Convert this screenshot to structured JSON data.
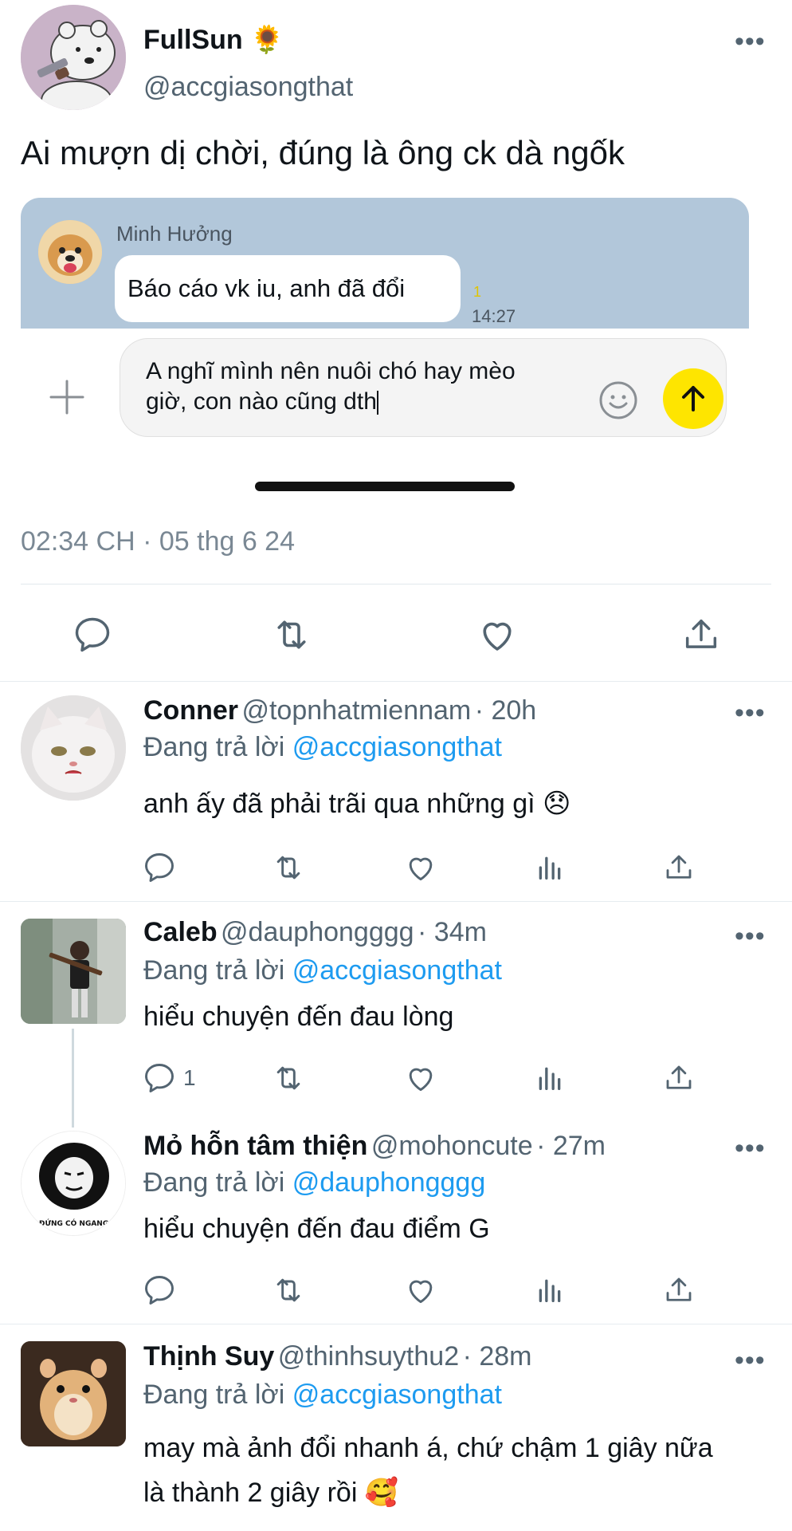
{
  "main_tweet": {
    "display_name": "FullSun",
    "name_emoji": "🌻",
    "handle": "@accgiasongthat",
    "text": "Ai mượn dị chời, đúng là ông ck dà ngốk",
    "timestamp": "02:34 CH · 05 thg 6 24",
    "embedded_chat": {
      "sender": "Minh Hưởng",
      "message": "Báo cáo vk iu, anh đã đổi",
      "read_count": "1",
      "time": "14:27",
      "input_text": "A nghĩ mình nên nuôi chó hay mèo giờ, con nào cũng dth",
      "input_line1": "A nghĩ mình nên nuôi chó hay mèo",
      "input_line2": "giờ, con nào cũng dth"
    }
  },
  "replying_prefix": "Đang trả lời",
  "replies": [
    {
      "name": "Conner",
      "handle": "@topnhatmiennam",
      "time": "· 20h",
      "replying_to": "@accgiasongthat",
      "text": "anh ấy đã phải trãi qua những gì 😞",
      "reply_count": ""
    },
    {
      "name": "Caleb",
      "handle": "@dauphongggg",
      "time": "· 34m",
      "replying_to": "@accgiasongthat",
      "text": "hiểu chuyện đến đau lòng",
      "reply_count": "1"
    },
    {
      "name": "Mỏ hỗn tâm thiện",
      "handle": "@mohoncute",
      "time": "· 27m",
      "replying_to": "@dauphongggg",
      "text": "hiểu chuyện đến đau điểm G",
      "reply_count": "",
      "avatar_caption": "MÀY ĐỨNG CÓ NGANG NGỨ"
    },
    {
      "name": "Thịnh Suy",
      "handle": "@thinhsuythu2",
      "time": "· 28m",
      "replying_to": "@accgiasongthat",
      "text_line1": "may mà ảnh đổi nhanh á, chứ chậm 1 giây nữa",
      "text_line2": "là thành 2 giây rồi 🥰"
    }
  ],
  "more_label": "•••",
  "colors": {
    "link": "#1d9bf0",
    "muted": "#536471",
    "chat_bg": "#b2c7da",
    "send_button": "#fee500"
  }
}
